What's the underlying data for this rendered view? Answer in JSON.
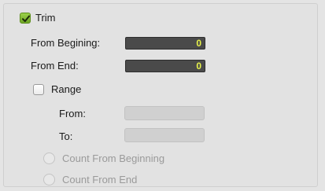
{
  "trim": {
    "label": "Trim",
    "checked": true,
    "from_beginning": {
      "label": "From Begining:",
      "value": "0"
    },
    "from_end": {
      "label": "From End:",
      "value": "0"
    }
  },
  "range": {
    "label": "Range",
    "checked": false,
    "from": {
      "label": "From:",
      "value": ""
    },
    "to": {
      "label": "To:",
      "value": ""
    },
    "options": [
      {
        "label": "Count From Beginning",
        "selected": false,
        "enabled": false
      },
      {
        "label": "Count From End",
        "selected": false,
        "enabled": false
      }
    ]
  },
  "colors": {
    "checkbox_checked": "#7bb52d",
    "field_value": "#e7f24a",
    "dark_field": "#4a4a4a"
  }
}
